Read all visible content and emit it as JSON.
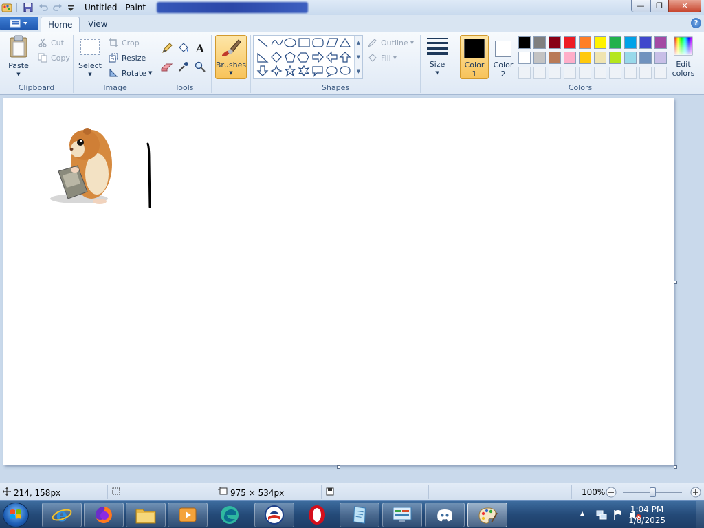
{
  "window": {
    "title": "Untitled - Paint",
    "min_label": "—",
    "max_label": "❐",
    "close_label": "✕"
  },
  "tabs": [
    {
      "label": "Home",
      "active": true
    },
    {
      "label": "View",
      "active": false
    }
  ],
  "help_label": "?",
  "clipboard": {
    "paste": "Paste",
    "cut": "Cut",
    "copy": "Copy",
    "label": "Clipboard"
  },
  "image": {
    "select": "Select",
    "crop": "Crop",
    "resize": "Resize",
    "rotate": "Rotate",
    "label": "Image"
  },
  "tools": {
    "label": "Tools",
    "text_glyph": "A"
  },
  "brushes": {
    "label": "Brushes"
  },
  "shapes": {
    "outline": "Outline",
    "fill": "Fill",
    "label": "Shapes"
  },
  "size": {
    "label": "Size"
  },
  "color1": {
    "label": "Color",
    "num": "1",
    "value": "#000000"
  },
  "color2": {
    "label": "Color",
    "num": "2",
    "value": "#ffffff"
  },
  "colors": {
    "label": "Colors",
    "edit_label": "Edit",
    "edit_label2": "colors",
    "row1": [
      "#000000",
      "#7f7f7f",
      "#880015",
      "#ed1c24",
      "#ff7f27",
      "#fff200",
      "#22b14c",
      "#00a2e8",
      "#3f48cc",
      "#a349a4"
    ],
    "row2": [
      "#ffffff",
      "#c3c3c3",
      "#b97a57",
      "#ffaec9",
      "#ffc90e",
      "#efe4b0",
      "#b5e61d",
      "#99d9ea",
      "#7092be",
      "#c8bfe7"
    ]
  },
  "status": {
    "cursor_pos": "214, 158px",
    "canvas_size": "975 × 534px",
    "zoom": "100%"
  },
  "taskbar": {
    "apps": [
      "internet-explorer",
      "firefox",
      "file-explorer",
      "media-player",
      "edge-legacy",
      "obama-campaign",
      "opera",
      "notepad-app",
      "control-panel",
      "discord",
      "paint"
    ]
  },
  "clock": {
    "time": "1:04 PM",
    "date": "1/8/2025"
  }
}
